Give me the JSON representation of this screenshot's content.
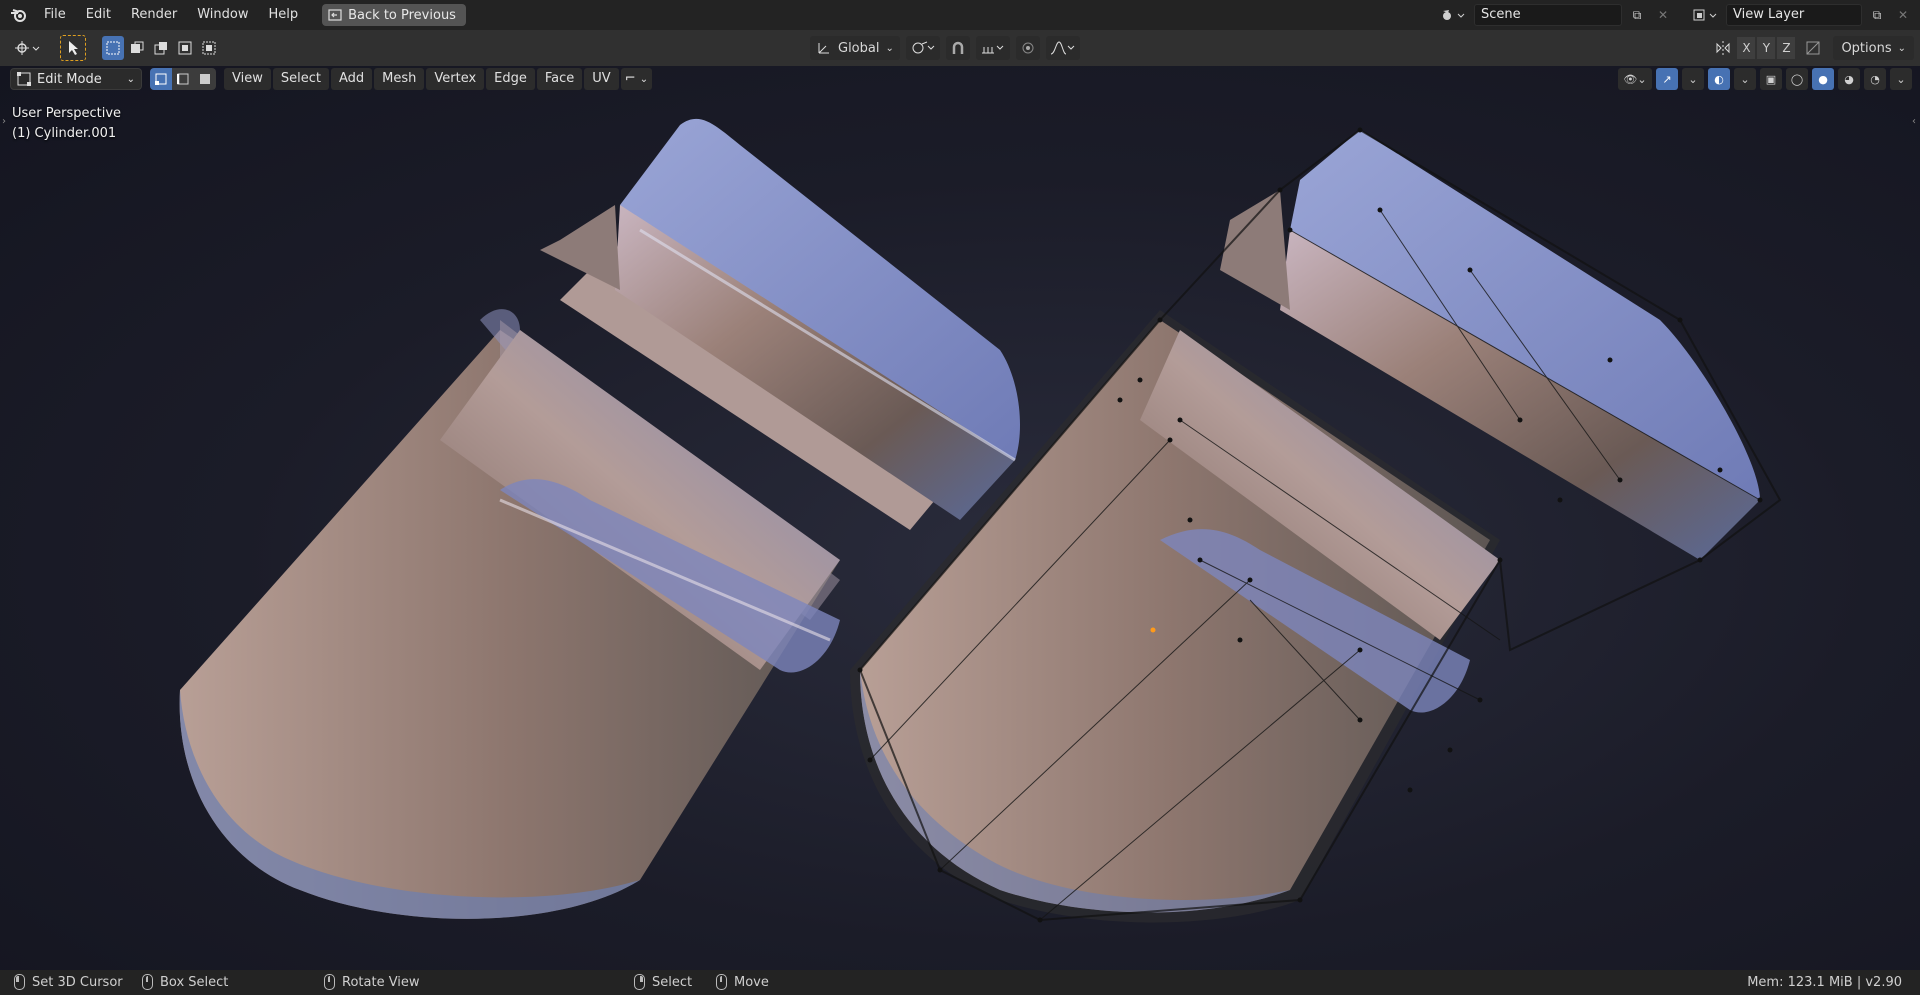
{
  "topbar": {
    "menus": [
      "File",
      "Edit",
      "Render",
      "Window",
      "Help"
    ],
    "back_label": "Back to Previous",
    "scene_name": "Scene",
    "view_layer_name": "View Layer"
  },
  "toolbar": {
    "transform_orientation": "Global",
    "axes": [
      "X",
      "Y",
      "Z"
    ],
    "options_label": "Options"
  },
  "viewport_header": {
    "mode": "Edit Mode",
    "menus": [
      "View",
      "Select",
      "Add",
      "Mesh",
      "Vertex",
      "Edge",
      "Face",
      "UV"
    ]
  },
  "viewport": {
    "perspective": "User Perspective",
    "object": "(1) Cylinder.001"
  },
  "statusbar": {
    "set_cursor": "Set 3D Cursor",
    "box_select": "Box Select",
    "rotate_view": "Rotate View",
    "select": "Select",
    "move": "Move",
    "mem": "Mem: 123.1 MiB | v2.90"
  },
  "colors": {
    "accent": "#4772b3",
    "background_top": "#232323",
    "header": "#303030"
  }
}
